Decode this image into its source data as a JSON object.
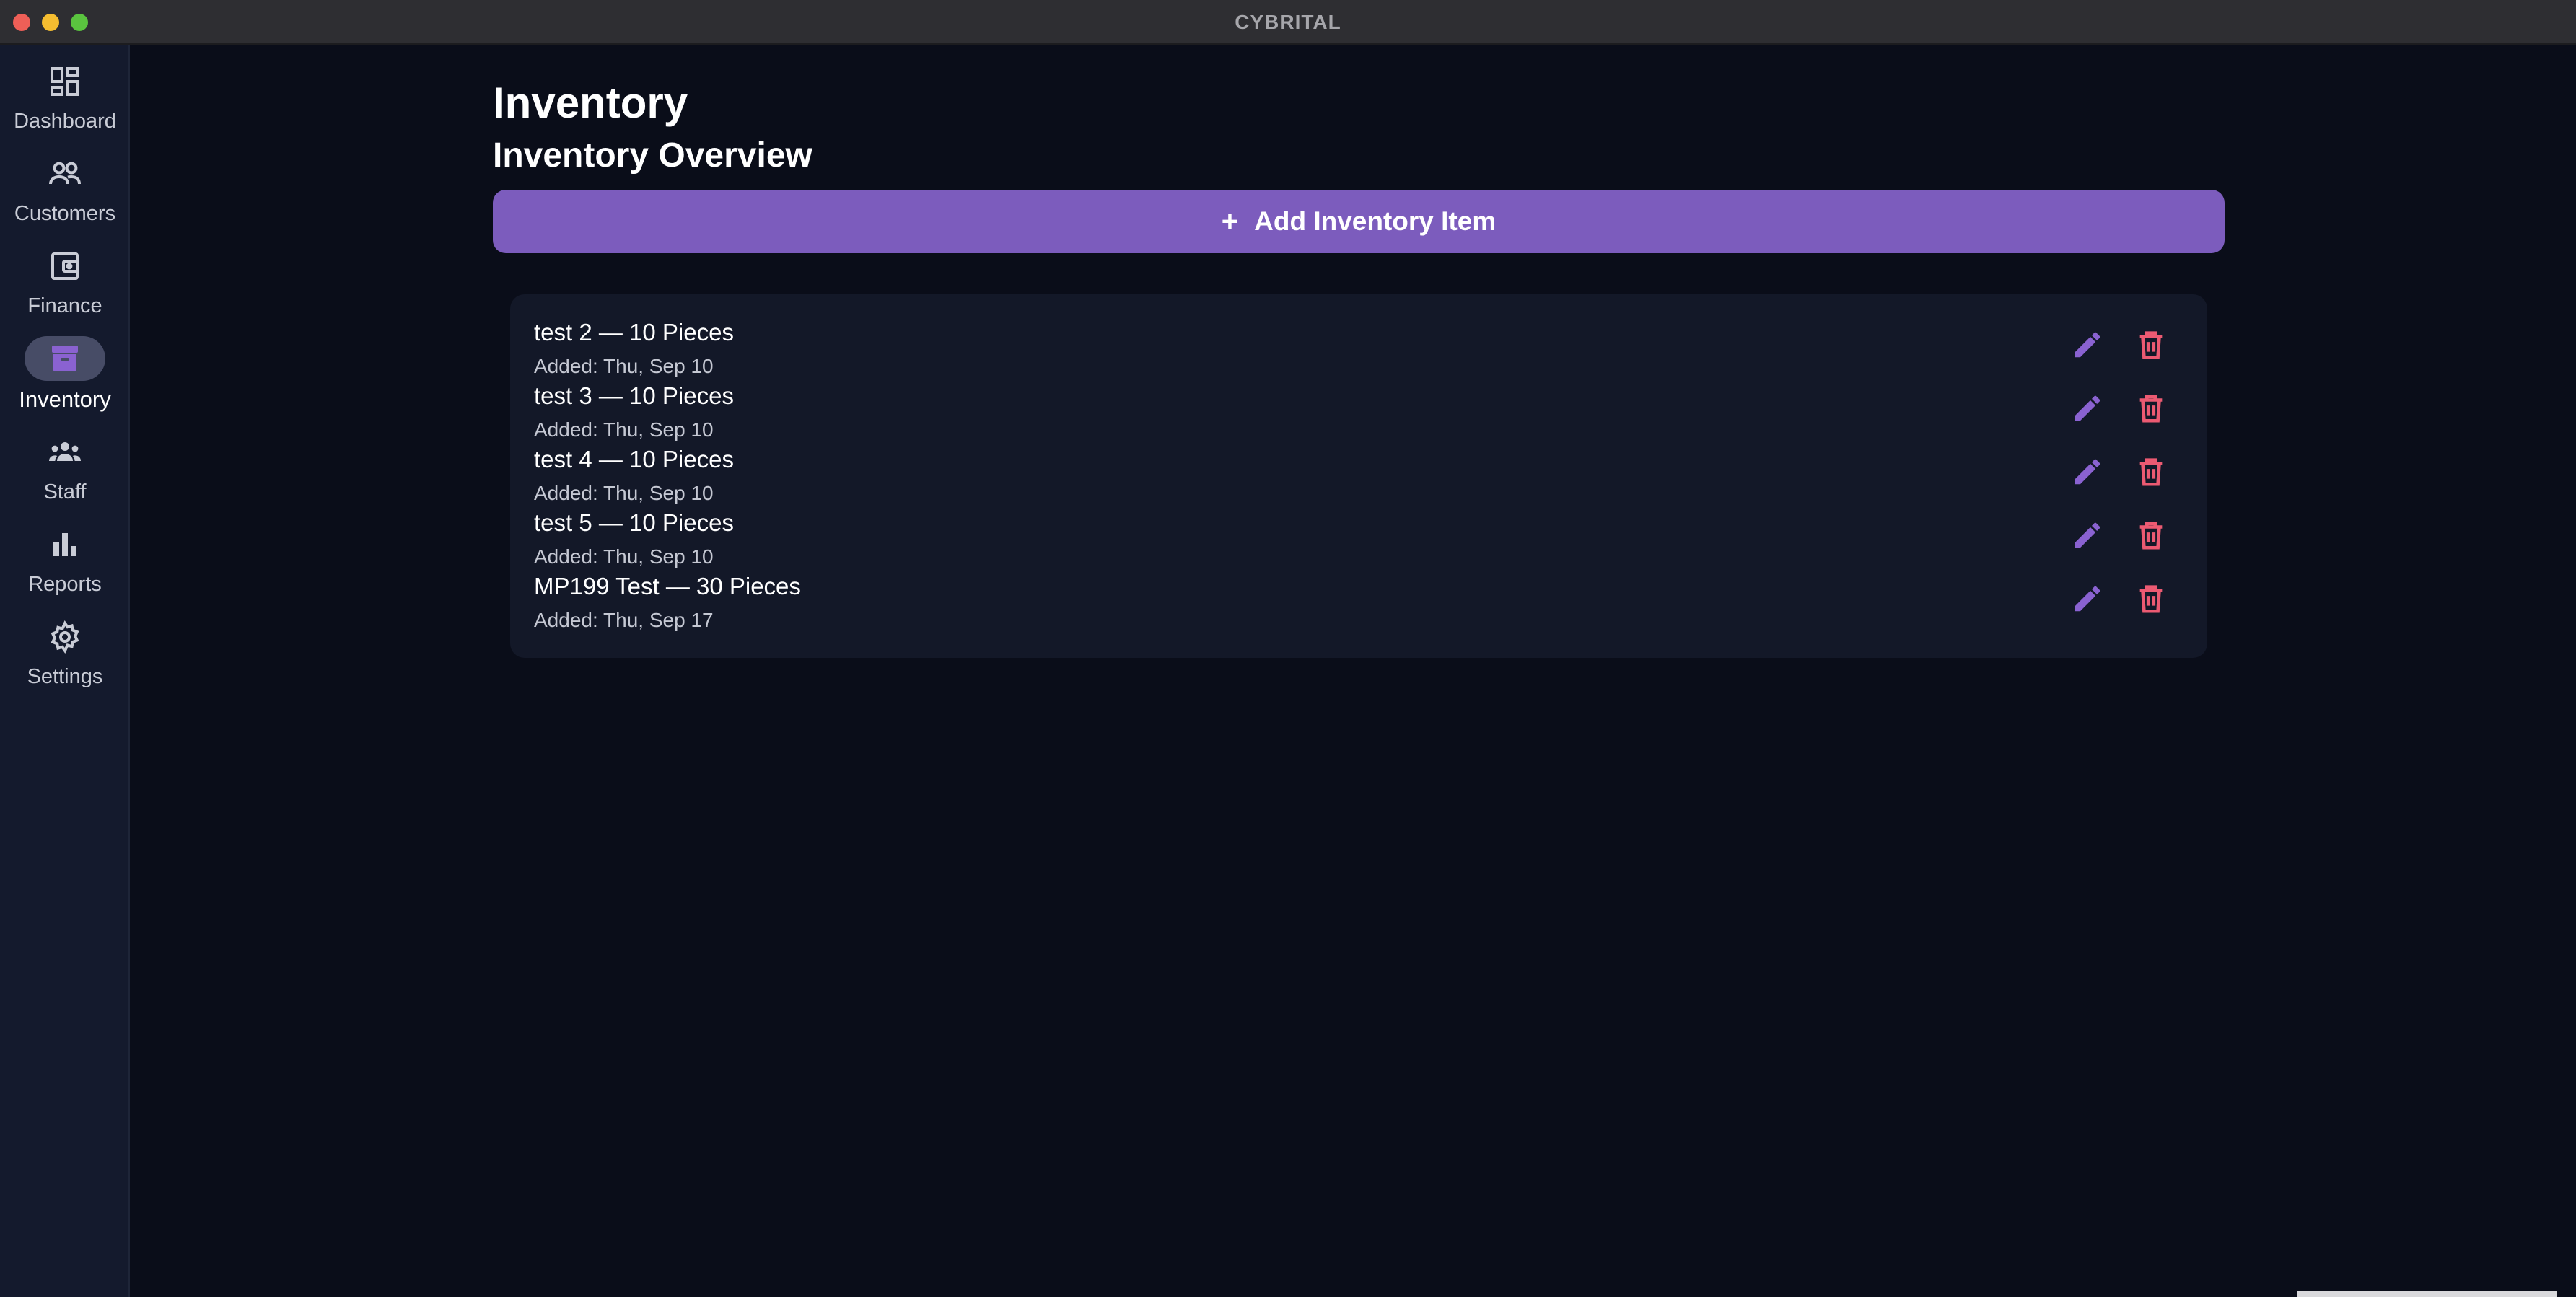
{
  "window": {
    "title": "CYBRITAL"
  },
  "sidebar": {
    "items": [
      {
        "label": "Dashboard",
        "icon": "dashboard-icon",
        "active": false
      },
      {
        "label": "Customers",
        "icon": "customers-icon",
        "active": false
      },
      {
        "label": "Finance",
        "icon": "wallet-icon",
        "active": false
      },
      {
        "label": "Inventory",
        "icon": "archive-box-icon",
        "active": true
      },
      {
        "label": "Staff",
        "icon": "staff-group-icon",
        "active": false
      },
      {
        "label": "Reports",
        "icon": "bar-chart-icon",
        "active": false
      },
      {
        "label": "Settings",
        "icon": "gear-icon",
        "active": false
      }
    ]
  },
  "main": {
    "page_title": "Inventory",
    "section_title": "Inventory Overview",
    "add_button": {
      "icon": "plus-icon",
      "plus": "+",
      "label": "Add Inventory Item"
    },
    "items": [
      {
        "title": "test 2 — 10 Pieces",
        "date": "Added: Thu, Sep 10"
      },
      {
        "title": "test 3 — 10 Pieces",
        "date": "Added: Thu, Sep 10"
      },
      {
        "title": "test 4 — 10 Pieces",
        "date": "Added: Thu, Sep 10"
      },
      {
        "title": "test 5 — 10 Pieces",
        "date": "Added: Thu, Sep 10"
      },
      {
        "title": "MP199 Test — 30 Pieces",
        "date": "Added: Thu, Sep 17"
      }
    ]
  },
  "colors": {
    "background": "#0a0d19",
    "sidebar": "#141a2d",
    "card": "#131828",
    "accent": "#7c5cbd",
    "edit_icon": "#8a62d1",
    "delete_icon": "#ec5a72"
  }
}
